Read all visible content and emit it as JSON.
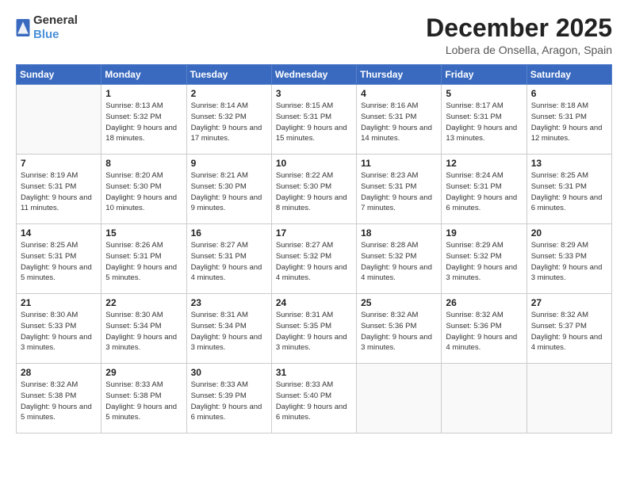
{
  "logo": {
    "general": "General",
    "blue": "Blue"
  },
  "header": {
    "month": "December 2025",
    "location": "Lobera de Onsella, Aragon, Spain"
  },
  "weekdays": [
    "Sunday",
    "Monday",
    "Tuesday",
    "Wednesday",
    "Thursday",
    "Friday",
    "Saturday"
  ],
  "weeks": [
    [
      {
        "day": "",
        "sunrise": "",
        "sunset": "",
        "daylight": ""
      },
      {
        "day": "1",
        "sunrise": "Sunrise: 8:13 AM",
        "sunset": "Sunset: 5:32 PM",
        "daylight": "Daylight: 9 hours and 18 minutes."
      },
      {
        "day": "2",
        "sunrise": "Sunrise: 8:14 AM",
        "sunset": "Sunset: 5:32 PM",
        "daylight": "Daylight: 9 hours and 17 minutes."
      },
      {
        "day": "3",
        "sunrise": "Sunrise: 8:15 AM",
        "sunset": "Sunset: 5:31 PM",
        "daylight": "Daylight: 9 hours and 15 minutes."
      },
      {
        "day": "4",
        "sunrise": "Sunrise: 8:16 AM",
        "sunset": "Sunset: 5:31 PM",
        "daylight": "Daylight: 9 hours and 14 minutes."
      },
      {
        "day": "5",
        "sunrise": "Sunrise: 8:17 AM",
        "sunset": "Sunset: 5:31 PM",
        "daylight": "Daylight: 9 hours and 13 minutes."
      },
      {
        "day": "6",
        "sunrise": "Sunrise: 8:18 AM",
        "sunset": "Sunset: 5:31 PM",
        "daylight": "Daylight: 9 hours and 12 minutes."
      }
    ],
    [
      {
        "day": "7",
        "sunrise": "Sunrise: 8:19 AM",
        "sunset": "Sunset: 5:31 PM",
        "daylight": "Daylight: 9 hours and 11 minutes."
      },
      {
        "day": "8",
        "sunrise": "Sunrise: 8:20 AM",
        "sunset": "Sunset: 5:30 PM",
        "daylight": "Daylight: 9 hours and 10 minutes."
      },
      {
        "day": "9",
        "sunrise": "Sunrise: 8:21 AM",
        "sunset": "Sunset: 5:30 PM",
        "daylight": "Daylight: 9 hours and 9 minutes."
      },
      {
        "day": "10",
        "sunrise": "Sunrise: 8:22 AM",
        "sunset": "Sunset: 5:30 PM",
        "daylight": "Daylight: 9 hours and 8 minutes."
      },
      {
        "day": "11",
        "sunrise": "Sunrise: 8:23 AM",
        "sunset": "Sunset: 5:31 PM",
        "daylight": "Daylight: 9 hours and 7 minutes."
      },
      {
        "day": "12",
        "sunrise": "Sunrise: 8:24 AM",
        "sunset": "Sunset: 5:31 PM",
        "daylight": "Daylight: 9 hours and 6 minutes."
      },
      {
        "day": "13",
        "sunrise": "Sunrise: 8:25 AM",
        "sunset": "Sunset: 5:31 PM",
        "daylight": "Daylight: 9 hours and 6 minutes."
      }
    ],
    [
      {
        "day": "14",
        "sunrise": "Sunrise: 8:25 AM",
        "sunset": "Sunset: 5:31 PM",
        "daylight": "Daylight: 9 hours and 5 minutes."
      },
      {
        "day": "15",
        "sunrise": "Sunrise: 8:26 AM",
        "sunset": "Sunset: 5:31 PM",
        "daylight": "Daylight: 9 hours and 5 minutes."
      },
      {
        "day": "16",
        "sunrise": "Sunrise: 8:27 AM",
        "sunset": "Sunset: 5:31 PM",
        "daylight": "Daylight: 9 hours and 4 minutes."
      },
      {
        "day": "17",
        "sunrise": "Sunrise: 8:27 AM",
        "sunset": "Sunset: 5:32 PM",
        "daylight": "Daylight: 9 hours and 4 minutes."
      },
      {
        "day": "18",
        "sunrise": "Sunrise: 8:28 AM",
        "sunset": "Sunset: 5:32 PM",
        "daylight": "Daylight: 9 hours and 4 minutes."
      },
      {
        "day": "19",
        "sunrise": "Sunrise: 8:29 AM",
        "sunset": "Sunset: 5:32 PM",
        "daylight": "Daylight: 9 hours and 3 minutes."
      },
      {
        "day": "20",
        "sunrise": "Sunrise: 8:29 AM",
        "sunset": "Sunset: 5:33 PM",
        "daylight": "Daylight: 9 hours and 3 minutes."
      }
    ],
    [
      {
        "day": "21",
        "sunrise": "Sunrise: 8:30 AM",
        "sunset": "Sunset: 5:33 PM",
        "daylight": "Daylight: 9 hours and 3 minutes."
      },
      {
        "day": "22",
        "sunrise": "Sunrise: 8:30 AM",
        "sunset": "Sunset: 5:34 PM",
        "daylight": "Daylight: 9 hours and 3 minutes."
      },
      {
        "day": "23",
        "sunrise": "Sunrise: 8:31 AM",
        "sunset": "Sunset: 5:34 PM",
        "daylight": "Daylight: 9 hours and 3 minutes."
      },
      {
        "day": "24",
        "sunrise": "Sunrise: 8:31 AM",
        "sunset": "Sunset: 5:35 PM",
        "daylight": "Daylight: 9 hours and 3 minutes."
      },
      {
        "day": "25",
        "sunrise": "Sunrise: 8:32 AM",
        "sunset": "Sunset: 5:36 PM",
        "daylight": "Daylight: 9 hours and 3 minutes."
      },
      {
        "day": "26",
        "sunrise": "Sunrise: 8:32 AM",
        "sunset": "Sunset: 5:36 PM",
        "daylight": "Daylight: 9 hours and 4 minutes."
      },
      {
        "day": "27",
        "sunrise": "Sunrise: 8:32 AM",
        "sunset": "Sunset: 5:37 PM",
        "daylight": "Daylight: 9 hours and 4 minutes."
      }
    ],
    [
      {
        "day": "28",
        "sunrise": "Sunrise: 8:32 AM",
        "sunset": "Sunset: 5:38 PM",
        "daylight": "Daylight: 9 hours and 5 minutes."
      },
      {
        "day": "29",
        "sunrise": "Sunrise: 8:33 AM",
        "sunset": "Sunset: 5:38 PM",
        "daylight": "Daylight: 9 hours and 5 minutes."
      },
      {
        "day": "30",
        "sunrise": "Sunrise: 8:33 AM",
        "sunset": "Sunset: 5:39 PM",
        "daylight": "Daylight: 9 hours and 6 minutes."
      },
      {
        "day": "31",
        "sunrise": "Sunrise: 8:33 AM",
        "sunset": "Sunset: 5:40 PM",
        "daylight": "Daylight: 9 hours and 6 minutes."
      },
      {
        "day": "",
        "sunrise": "",
        "sunset": "",
        "daylight": ""
      },
      {
        "day": "",
        "sunrise": "",
        "sunset": "",
        "daylight": ""
      },
      {
        "day": "",
        "sunrise": "",
        "sunset": "",
        "daylight": ""
      }
    ]
  ]
}
